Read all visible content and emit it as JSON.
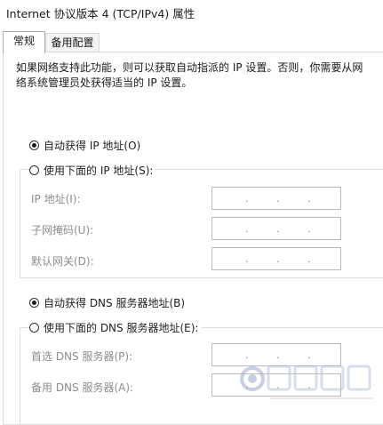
{
  "window": {
    "title": "Internet 协议版本 4 (TCP/IPv4) 属性"
  },
  "tabs": [
    {
      "label": "常规",
      "active": true
    },
    {
      "label": "备用配置",
      "active": false
    }
  ],
  "description": "如果网络支持此功能，则可以获取自动指派的 IP 设置。否则，你需要从网络系统管理员处获得适当的 IP 设置。",
  "ip_section": {
    "auto_label": "自动获得 IP 地址(O)",
    "auto_selected": true,
    "manual_label": "使用下面的 IP 地址(S):",
    "manual_selected": false,
    "fields": [
      {
        "label": "IP 地址(I):",
        "value": ""
      },
      {
        "label": "子网掩码(U):",
        "value": ""
      },
      {
        "label": "默认网关(D):",
        "value": ""
      }
    ]
  },
  "dns_section": {
    "auto_label": "自动获得 DNS 服务器地址(B)",
    "auto_selected": true,
    "manual_label": "使用下面的 DNS 服务器地址(E):",
    "manual_selected": false,
    "fields": [
      {
        "label": "首选 DNS 服务器(P):",
        "value": ""
      },
      {
        "label": "备用 DNS 服务器(A):",
        "value": ""
      }
    ]
  },
  "ip_placeholder_dots": ".",
  "icons": {
    "watermark": "site-logo-watermark"
  }
}
